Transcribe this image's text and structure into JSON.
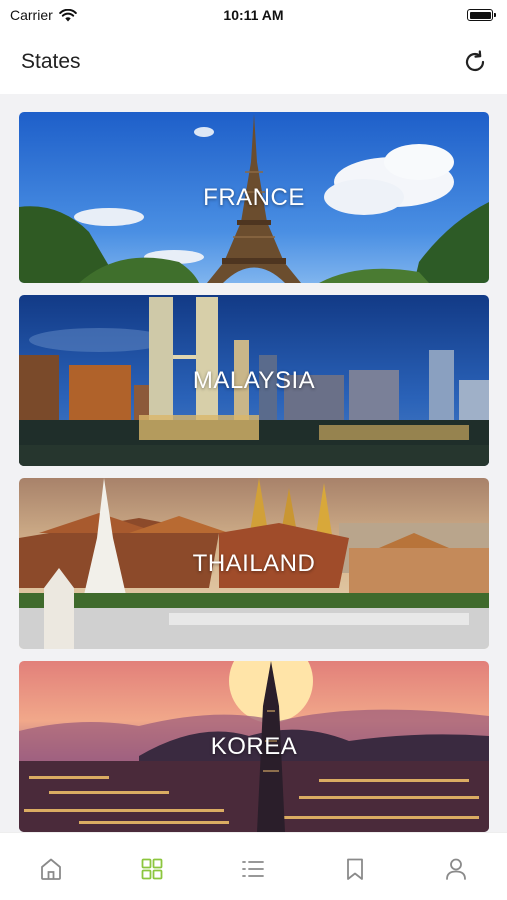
{
  "status_bar": {
    "carrier": "Carrier",
    "time": "10:11 AM",
    "battery_level": 1.0
  },
  "header": {
    "title": "States"
  },
  "cards": [
    {
      "label": "FRANCE"
    },
    {
      "label": "MALAYSIA"
    },
    {
      "label": "THAILAND"
    },
    {
      "label": "KOREA"
    }
  ],
  "tab_bar": {
    "active_color": "#8cc63e",
    "inactive_color": "#8a8a8a",
    "tabs": [
      {
        "icon": "home-icon",
        "active": false
      },
      {
        "icon": "grid-icon",
        "active": true
      },
      {
        "icon": "list-icon",
        "active": false
      },
      {
        "icon": "bookmark-icon",
        "active": false
      },
      {
        "icon": "profile-icon",
        "active": false
      }
    ]
  }
}
